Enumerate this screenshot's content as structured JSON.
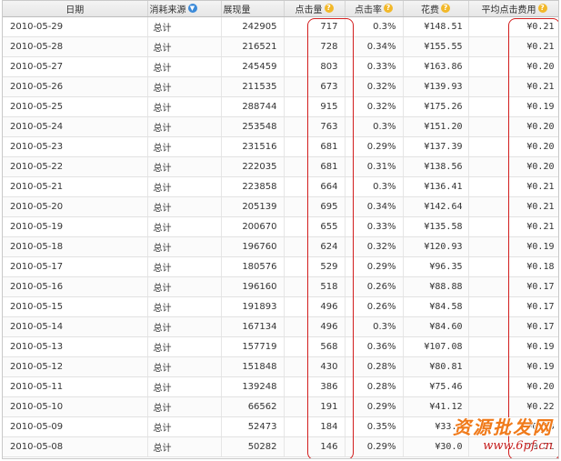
{
  "header": {
    "date": "日期",
    "source": "消耗来源",
    "impressions": "展现量",
    "clicks": "点击量",
    "ctr": "点击率",
    "cost": "花费",
    "avg_cpc": "平均点击费用"
  },
  "icons": {
    "help": "question-mark-icon",
    "sort": "sort-arrow-icon"
  },
  "colors": {
    "highlight": "#d21e1e",
    "help_icon": "#f2b829",
    "sort_icon": "#3b8ad9"
  },
  "rows": [
    {
      "date": "2010-05-29",
      "source": "总计",
      "impressions": "242905",
      "clicks": "717",
      "ctr": "0.3%",
      "cost": "¥148.51",
      "avg": "¥0.21"
    },
    {
      "date": "2010-05-28",
      "source": "总计",
      "impressions": "216521",
      "clicks": "728",
      "ctr": "0.34%",
      "cost": "¥155.55",
      "avg": "¥0.21"
    },
    {
      "date": "2010-05-27",
      "source": "总计",
      "impressions": "245459",
      "clicks": "803",
      "ctr": "0.33%",
      "cost": "¥163.86",
      "avg": "¥0.20"
    },
    {
      "date": "2010-05-26",
      "source": "总计",
      "impressions": "211535",
      "clicks": "673",
      "ctr": "0.32%",
      "cost": "¥139.93",
      "avg": "¥0.21"
    },
    {
      "date": "2010-05-25",
      "source": "总计",
      "impressions": "288744",
      "clicks": "915",
      "ctr": "0.32%",
      "cost": "¥175.26",
      "avg": "¥0.19"
    },
    {
      "date": "2010-05-24",
      "source": "总计",
      "impressions": "253548",
      "clicks": "763",
      "ctr": "0.3%",
      "cost": "¥151.20",
      "avg": "¥0.20"
    },
    {
      "date": "2010-05-23",
      "source": "总计",
      "impressions": "231516",
      "clicks": "681",
      "ctr": "0.29%",
      "cost": "¥137.39",
      "avg": "¥0.20"
    },
    {
      "date": "2010-05-22",
      "source": "总计",
      "impressions": "222035",
      "clicks": "681",
      "ctr": "0.31%",
      "cost": "¥138.56",
      "avg": "¥0.20"
    },
    {
      "date": "2010-05-21",
      "source": "总计",
      "impressions": "223858",
      "clicks": "664",
      "ctr": "0.3%",
      "cost": "¥136.41",
      "avg": "¥0.21"
    },
    {
      "date": "2010-05-20",
      "source": "总计",
      "impressions": "205139",
      "clicks": "695",
      "ctr": "0.34%",
      "cost": "¥142.64",
      "avg": "¥0.21"
    },
    {
      "date": "2010-05-19",
      "source": "总计",
      "impressions": "200670",
      "clicks": "655",
      "ctr": "0.33%",
      "cost": "¥135.58",
      "avg": "¥0.21"
    },
    {
      "date": "2010-05-18",
      "source": "总计",
      "impressions": "196760",
      "clicks": "624",
      "ctr": "0.32%",
      "cost": "¥120.93",
      "avg": "¥0.19"
    },
    {
      "date": "2010-05-17",
      "source": "总计",
      "impressions": "180576",
      "clicks": "529",
      "ctr": "0.29%",
      "cost": "¥96.35",
      "avg": "¥0.18"
    },
    {
      "date": "2010-05-16",
      "source": "总计",
      "impressions": "196160",
      "clicks": "518",
      "ctr": "0.26%",
      "cost": "¥88.88",
      "avg": "¥0.17"
    },
    {
      "date": "2010-05-15",
      "source": "总计",
      "impressions": "191893",
      "clicks": "496",
      "ctr": "0.26%",
      "cost": "¥84.58",
      "avg": "¥0.17"
    },
    {
      "date": "2010-05-14",
      "source": "总计",
      "impressions": "167134",
      "clicks": "496",
      "ctr": "0.3%",
      "cost": "¥84.60",
      "avg": "¥0.17"
    },
    {
      "date": "2010-05-13",
      "source": "总计",
      "impressions": "157719",
      "clicks": "568",
      "ctr": "0.36%",
      "cost": "¥107.08",
      "avg": "¥0.19"
    },
    {
      "date": "2010-05-12",
      "source": "总计",
      "impressions": "151848",
      "clicks": "430",
      "ctr": "0.28%",
      "cost": "¥80.81",
      "avg": "¥0.19"
    },
    {
      "date": "2010-05-11",
      "source": "总计",
      "impressions": "139248",
      "clicks": "386",
      "ctr": "0.28%",
      "cost": "¥75.46",
      "avg": "¥0.20"
    },
    {
      "date": "2010-05-10",
      "source": "总计",
      "impressions": "66562",
      "clicks": "191",
      "ctr": "0.29%",
      "cost": "¥41.12",
      "avg": "¥0.22"
    },
    {
      "date": "2010-05-09",
      "source": "总计",
      "impressions": "52473",
      "clicks": "184",
      "ctr": "0.35%",
      "cost": "¥33.7",
      "avg": "¥0.18"
    },
    {
      "date": "2010-05-08",
      "source": "总计",
      "impressions": "50282",
      "clicks": "146",
      "ctr": "0.29%",
      "cost": "¥30.0",
      "avg": "¥0.21"
    }
  ],
  "watermark": {
    "text": "资源批发网",
    "url": "www.6pf.cn"
  }
}
